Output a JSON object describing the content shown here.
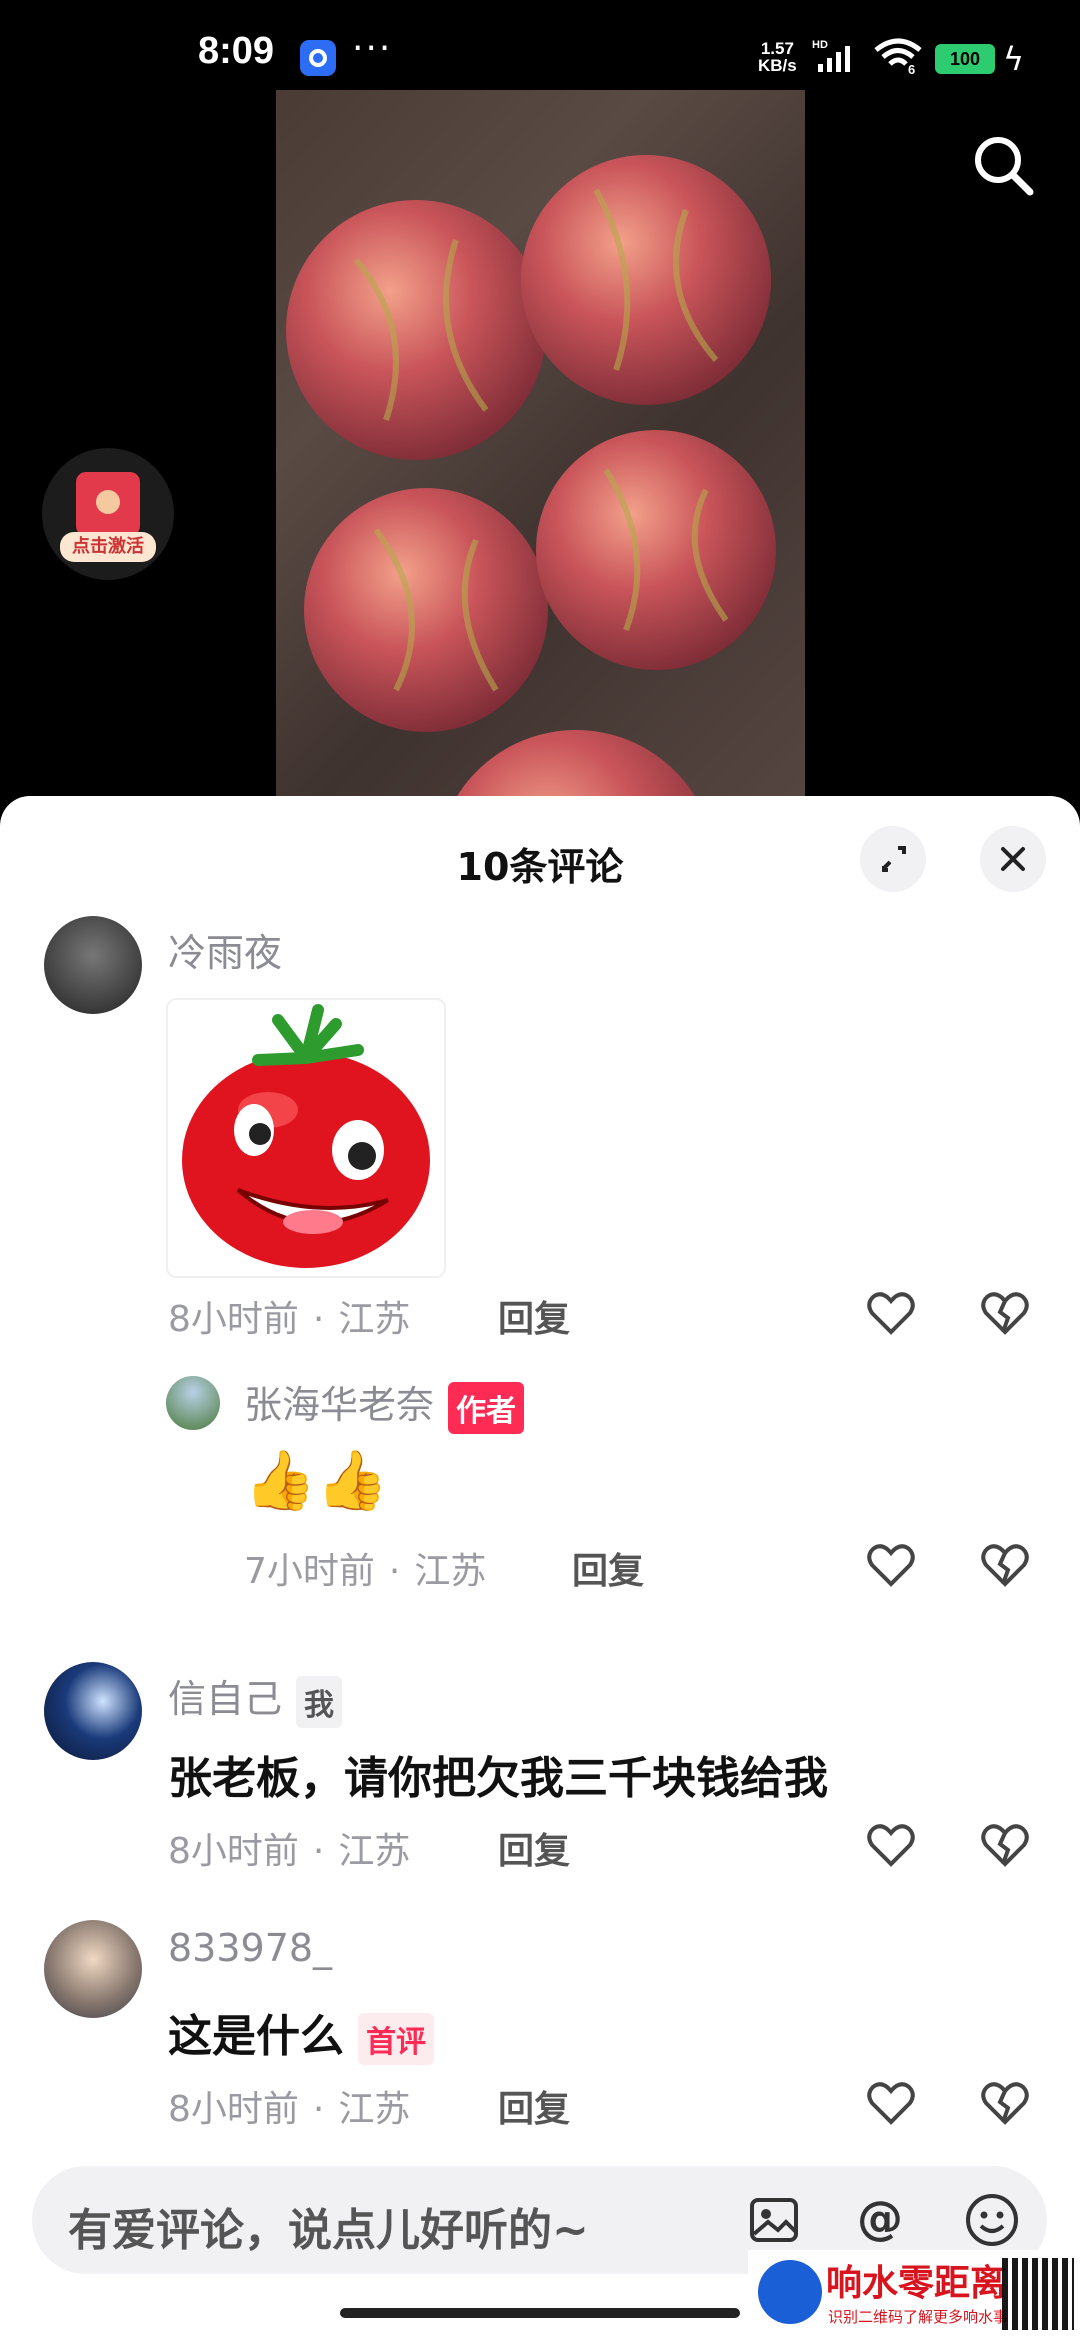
{
  "status_bar": {
    "time": "8:09",
    "dots": "···",
    "speed_value": "1.57",
    "speed_unit": "KB/s",
    "network": "HD",
    "wifi_level": "6",
    "battery": "100"
  },
  "overlay": {
    "activate_label": "点击激活"
  },
  "sheet": {
    "title": "10条评论"
  },
  "comments": [
    {
      "user": "冷雨夜",
      "time": "8小时前",
      "location": "江苏",
      "reply": "回复"
    },
    {
      "user": "张海华老奈",
      "tag": "作者",
      "text": "👍👍",
      "time": "7小时前",
      "location": "江苏",
      "reply": "回复"
    },
    {
      "user": "信自己",
      "tag": "我",
      "text": "张老板，请你把欠我三千块钱给我",
      "time": "8小时前",
      "location": "江苏",
      "reply": "回复"
    },
    {
      "user": "833978_",
      "text": "这是什么",
      "tag": "首评",
      "time": "8小时前",
      "location": "江苏",
      "reply": "回复"
    }
  ],
  "meta_sep": "·",
  "input": {
    "placeholder": "有爱评论，说点儿好听的~"
  },
  "watermark": {
    "title": "响水零距离",
    "subtitle": "识别二维码了解更多响水事"
  },
  "colors": {
    "accent": "#fe2c55",
    "sheet_bg": "#ffffff",
    "input_bg": "#f1f1f3"
  }
}
